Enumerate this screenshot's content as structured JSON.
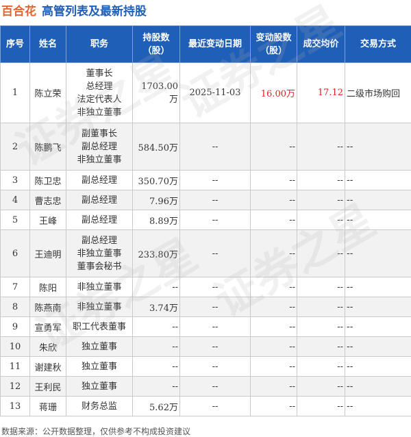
{
  "header": {
    "stock_name": "百合花",
    "table_title": "高管列表及最新持股"
  },
  "columns": [
    "序号",
    "姓名",
    "职务",
    "持股数\n（股）",
    "最近变动日期",
    "变动股数\n（股）",
    "成交均价",
    "交易方式"
  ],
  "rows": [
    {
      "no": "1",
      "name": "陈立荣",
      "roles": [
        "董事长",
        "总经理",
        "法定代表人",
        "非独立董事"
      ],
      "hold": "1703.00",
      "hold_unit": "万",
      "date": "2025-11-03",
      "change": "16.00",
      "change_unit": "万",
      "price": "17.12",
      "type": "二级市场购回"
    },
    {
      "no": "2",
      "name": "陈鹏飞",
      "roles": [
        "副董事长",
        "副总经理",
        "非独立董事"
      ],
      "hold": "584.50",
      "hold_unit": "万",
      "date": "--",
      "change": "--",
      "change_unit": "",
      "price": "--",
      "type": "--"
    },
    {
      "no": "3",
      "name": "陈卫忠",
      "roles": [
        "副总经理"
      ],
      "hold": "350.70",
      "hold_unit": "万",
      "date": "--",
      "change": "--",
      "change_unit": "",
      "price": "--",
      "type": "--"
    },
    {
      "no": "4",
      "name": "曹志忠",
      "roles": [
        "副总经理"
      ],
      "hold": "7.96",
      "hold_unit": "万",
      "date": "--",
      "change": "--",
      "change_unit": "",
      "price": "--",
      "type": "--"
    },
    {
      "no": "5",
      "name": "王峰",
      "roles": [
        "副总经理"
      ],
      "hold": "8.89",
      "hold_unit": "万",
      "date": "--",
      "change": "--",
      "change_unit": "",
      "price": "--",
      "type": "--"
    },
    {
      "no": "6",
      "name": "王迪明",
      "roles": [
        "副总经理",
        "非独立董事",
        "董事会秘书"
      ],
      "hold": "233.80",
      "hold_unit": "万",
      "date": "--",
      "change": "--",
      "change_unit": "",
      "price": "--",
      "type": "--"
    },
    {
      "no": "7",
      "name": "陈阳",
      "roles": [
        "非独立董事"
      ],
      "hold": "--",
      "hold_unit": "",
      "date": "--",
      "change": "--",
      "change_unit": "",
      "price": "--",
      "type": "--"
    },
    {
      "no": "8",
      "name": "陈燕南",
      "roles": [
        "非独立董事"
      ],
      "hold": "3.74",
      "hold_unit": "万",
      "date": "--",
      "change": "--",
      "change_unit": "",
      "price": "--",
      "type": "--"
    },
    {
      "no": "9",
      "name": "宣勇军",
      "roles": [
        "职工代表董事"
      ],
      "hold": "--",
      "hold_unit": "",
      "date": "--",
      "change": "--",
      "change_unit": "",
      "price": "--",
      "type": "--"
    },
    {
      "no": "10",
      "name": "朱欣",
      "roles": [
        "独立董事"
      ],
      "hold": "--",
      "hold_unit": "",
      "date": "--",
      "change": "--",
      "change_unit": "",
      "price": "--",
      "type": "--"
    },
    {
      "no": "11",
      "name": "谢建秋",
      "roles": [
        "独立董事"
      ],
      "hold": "--",
      "hold_unit": "",
      "date": "--",
      "change": "--",
      "change_unit": "",
      "price": "--",
      "type": "--"
    },
    {
      "no": "12",
      "name": "王利民",
      "roles": [
        "独立董事"
      ],
      "hold": "--",
      "hold_unit": "",
      "date": "--",
      "change": "--",
      "change_unit": "",
      "price": "--",
      "type": "--"
    },
    {
      "no": "13",
      "name": "蒋珊",
      "roles": [
        "财务总监"
      ],
      "hold": "5.62",
      "hold_unit": "万",
      "date": "--",
      "change": "--",
      "change_unit": "",
      "price": "--",
      "type": "--"
    }
  ],
  "highlight_color": "#e02020",
  "header_color": "#1f5fb8",
  "stock_name_color": "#e8632b",
  "source_note": "数据来源：公开数据整理，仅供参考不构成投资建议",
  "watermark_text": "证券之星"
}
